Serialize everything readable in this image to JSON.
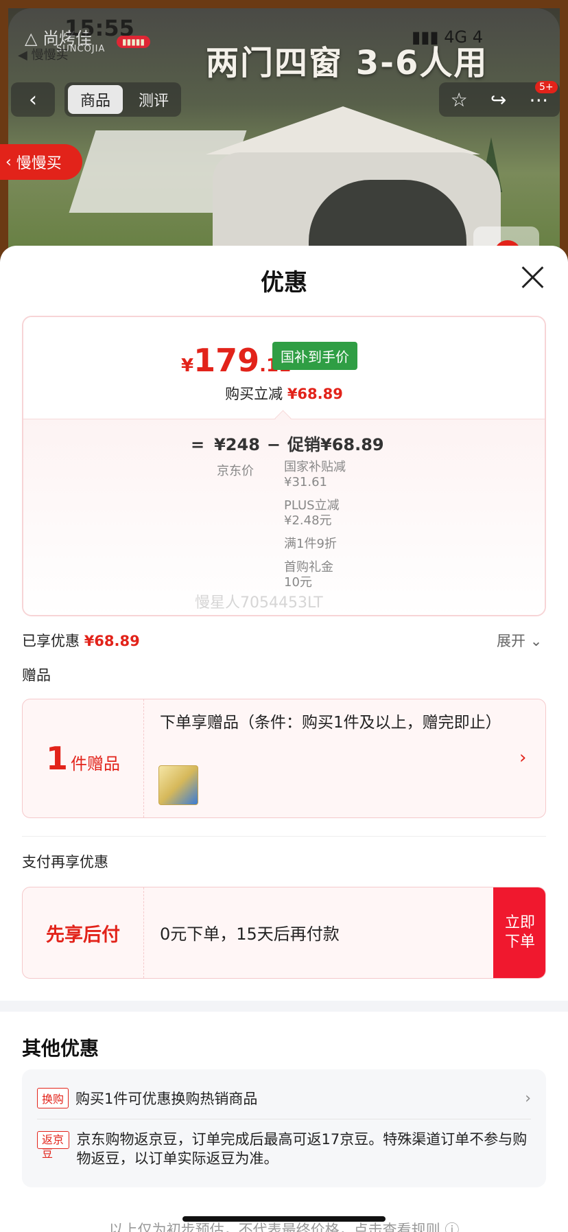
{
  "status_bar": {
    "time": "15:55",
    "network": "4G",
    "battery": "4",
    "back_app": "慢慢买"
  },
  "hero": {
    "brand": "尚烤佳",
    "brand_sub": "SUNCOJIA",
    "title": "两门四窗 3-6人用",
    "tabs": [
      {
        "label": "商品",
        "active": true
      },
      {
        "label": "测评",
        "active": false
      }
    ],
    "cart_badge": "5+",
    "slow_buy": "慢慢买"
  },
  "sheet": {
    "title": "优惠",
    "price": {
      "currency": "¥",
      "integer": "179",
      "decimal": ".11",
      "tag": "国补到手价"
    },
    "saving_label": "购买立减",
    "saving_value": "¥68.89",
    "formula": {
      "eq": "=",
      "jd_price": "¥248",
      "minus": "−",
      "promo": "促销¥68.89",
      "jd_label": "京东价"
    },
    "promo_items": [
      {
        "name": "国家补贴减",
        "value": "¥31.61"
      },
      {
        "name": "PLUS立减",
        "value": "¥2.48元"
      },
      {
        "name": "满1件9折",
        "value": ""
      },
      {
        "name": "首购礼金",
        "value": "10元"
      }
    ],
    "watermark": "慢星人7054453LT",
    "enjoyed_label": "已享优惠",
    "enjoyed_value": "¥68.89",
    "expand": "展开",
    "gift_section": "赠品",
    "gift": {
      "count": "1",
      "unit": "件赠品",
      "text": "下单享赠品（条件：购买1件及以上，赠完即止）"
    },
    "pay_section": "支付再享优惠",
    "pay": {
      "title": "先享后付",
      "text": "0元下单，15天后再付款",
      "button": "立即下单"
    },
    "other_title": "其他优惠",
    "other": [
      {
        "tag": "换购",
        "text": "购买1件可优惠换购热销商品"
      },
      {
        "tag": "返京豆",
        "text": "京东购物返京豆，订单完成后最高可返17京豆。特殊渠道订单不参与购物返豆，以订单实际返豆为准。"
      }
    ],
    "footnote": "以上仅为初步预估，不代表最终价格，点击查看规则 ⓘ"
  },
  "colors": {
    "accent": "#e2231a",
    "gov_tag": "#2f9e44"
  }
}
